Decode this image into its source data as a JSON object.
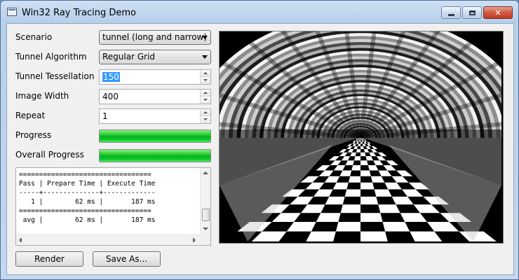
{
  "window": {
    "title": "Win32 Ray Tracing Demo",
    "caption_buttons": {
      "minimize": "minimize-icon",
      "maximize": "maximize-icon",
      "close": "close-icon"
    }
  },
  "form": {
    "scenario": {
      "label": "Scenario",
      "value": "tunnel (long and narrow)"
    },
    "tunnel_algorithm": {
      "label": "Tunnel Algorithm",
      "value": "Regular Grid"
    },
    "tunnel_tessellation": {
      "label": "Tunnel Tessellation",
      "value": "150"
    },
    "image_width": {
      "label": "Image Width",
      "value": "400"
    },
    "repeat": {
      "label": "Repeat",
      "value": "1"
    },
    "progress": {
      "label": "Progress",
      "fraction": 1.0
    },
    "overall_progress": {
      "label": "Overall Progress",
      "fraction": 1.0
    }
  },
  "log": {
    "lines": [
      "=================================",
      "Pass | Prepare Time | Execute Time",
      "-----+--------------+-------------",
      "   1 |        62 ms |       187 ms",
      "=================================",
      " avg |        62 ms |       187 ms"
    ]
  },
  "buttons": {
    "render": "Render",
    "save_as": "Save As..."
  },
  "colors": {
    "progress_green": "#06b025",
    "selection_blue": "#3399ff",
    "close_red": "#c03a22"
  }
}
